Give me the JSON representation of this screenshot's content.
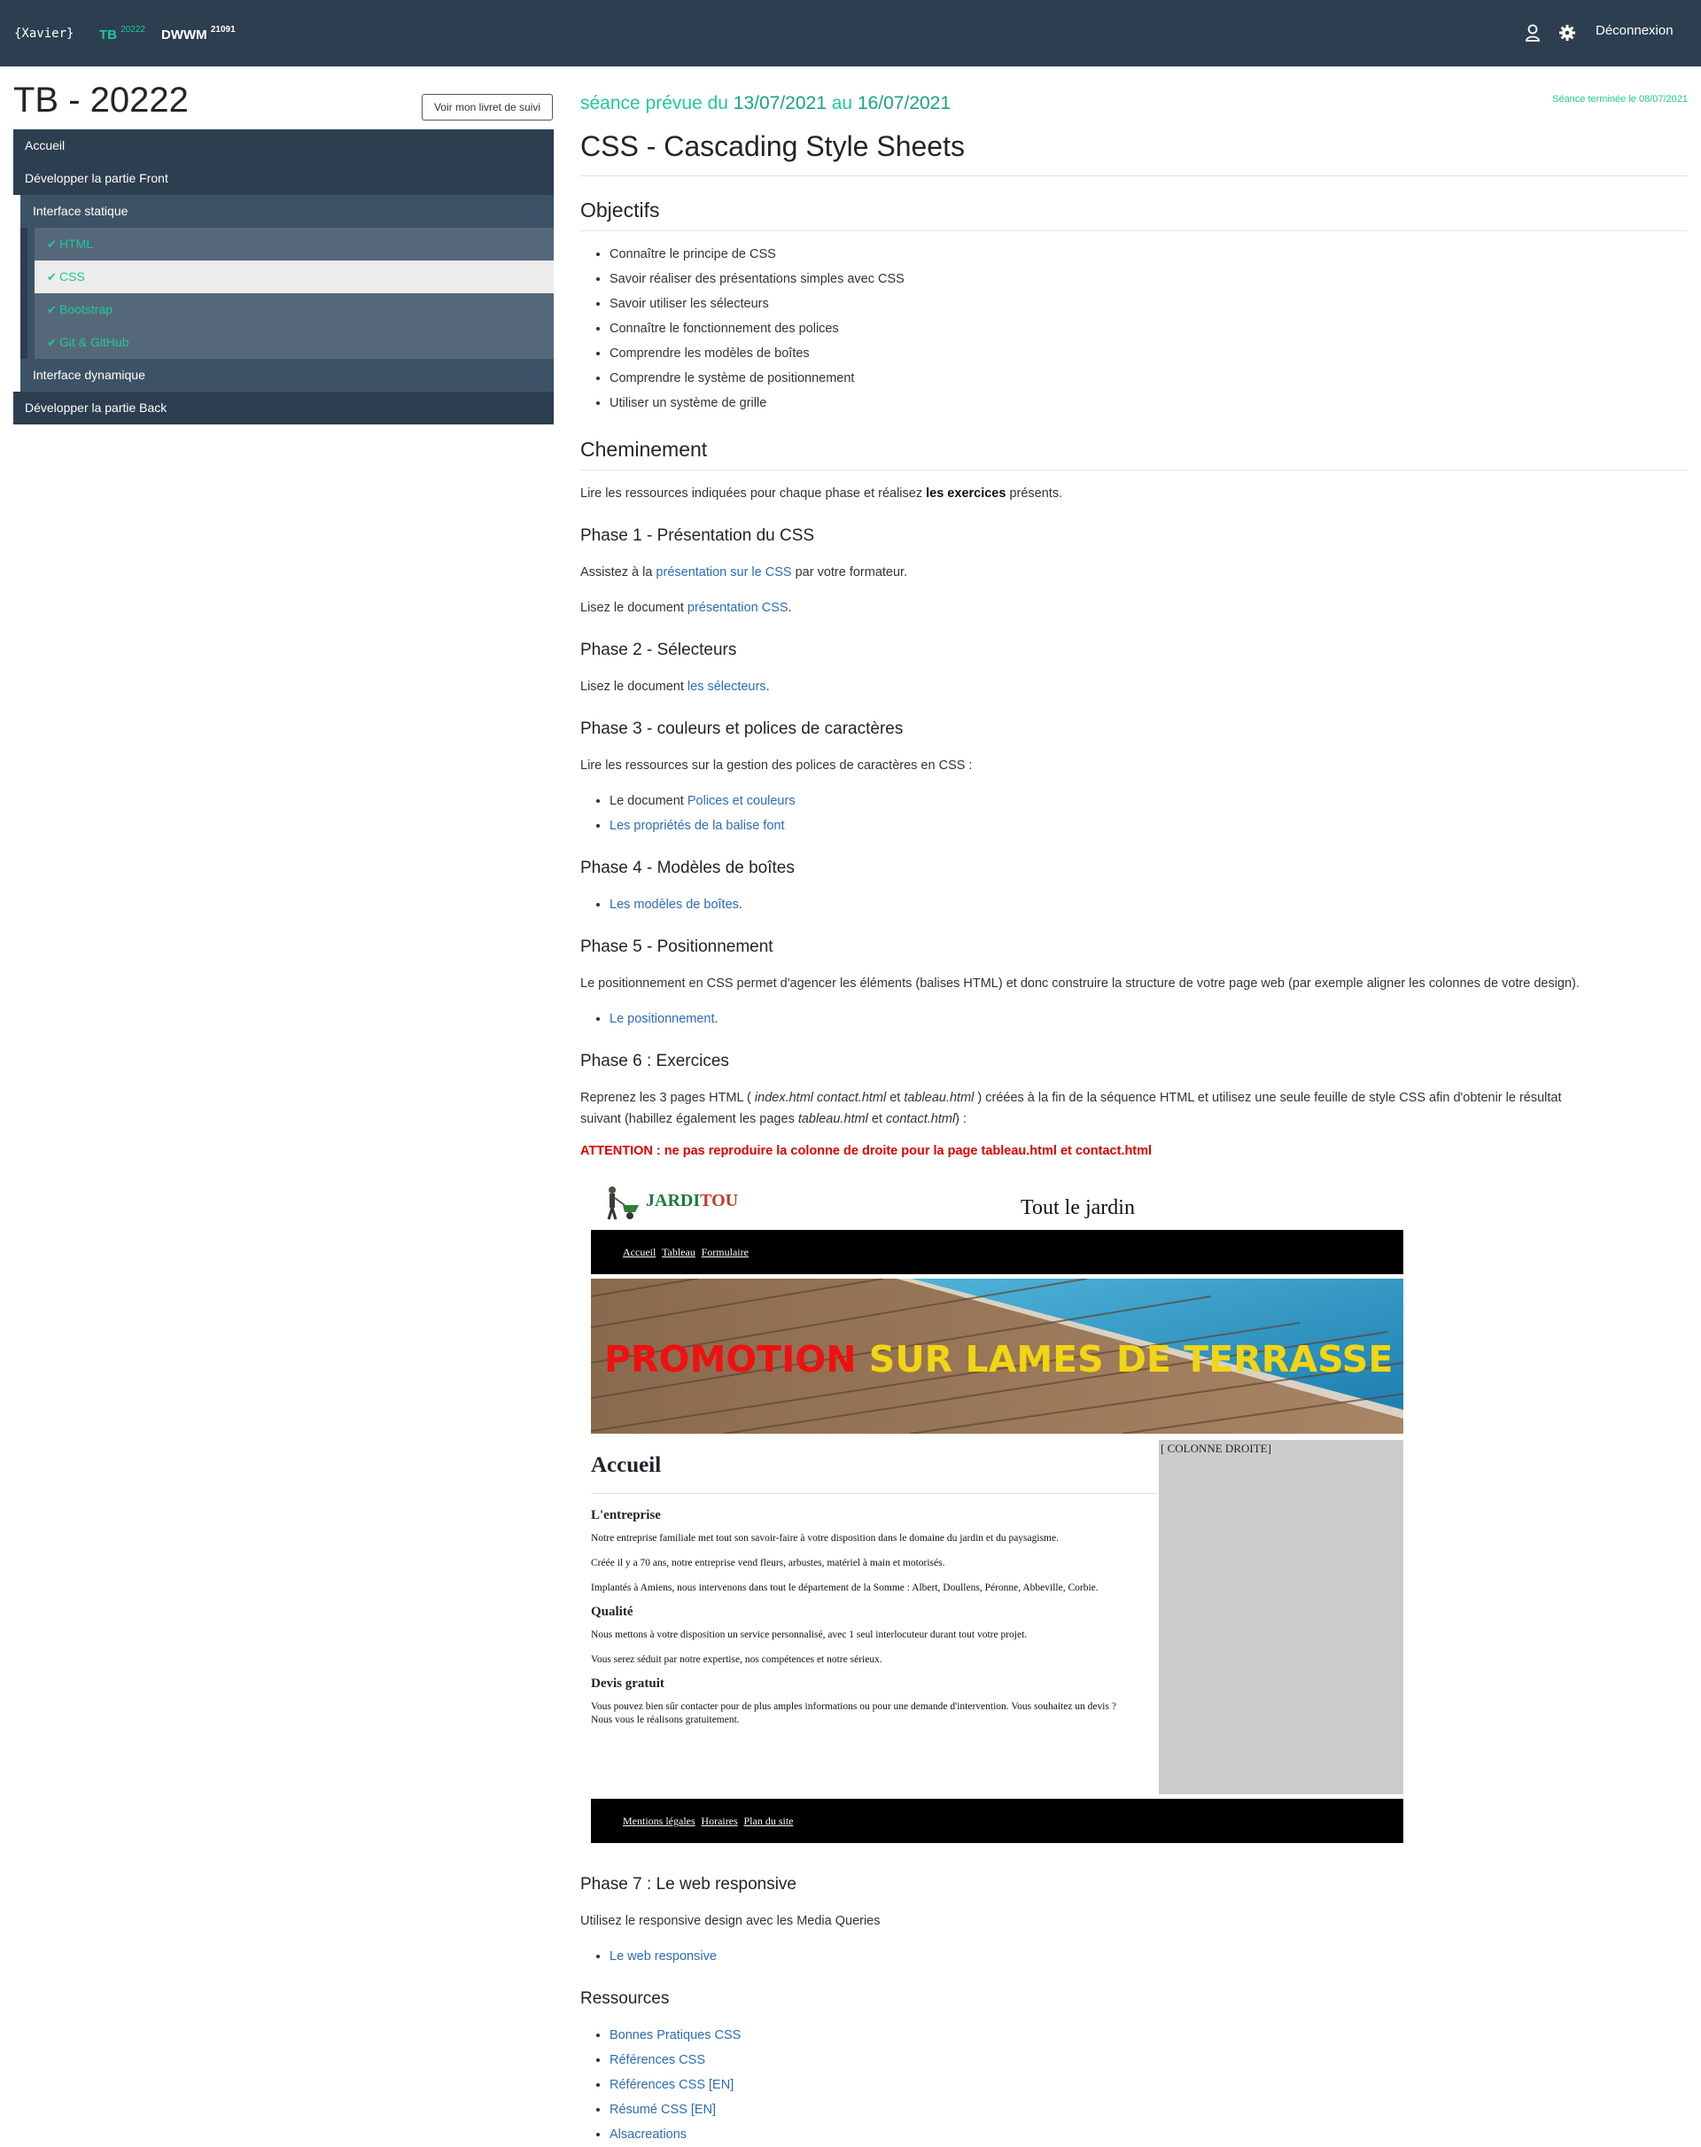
{
  "topbar": {
    "brand": "{Xavier}",
    "tb_label": "TB",
    "tb_sup": "20222",
    "dwwm_label": "DWWM",
    "dwwm_sup": "21091",
    "user_icon": "user-icon",
    "settings_icon": "gear-icon",
    "logout": "Déconnexion"
  },
  "sidebar": {
    "title": "TB - 20222",
    "livret_button": "Voir mon livret de suivi",
    "items": [
      {
        "label": "Accueil"
      },
      {
        "label": "Développer la partie Front"
      },
      {
        "label": "Interface statique"
      },
      {
        "label": "HTML"
      },
      {
        "label": "CSS"
      },
      {
        "label": "Bootstrap"
      },
      {
        "label": "Git & GitHub"
      },
      {
        "label": "Interface dynamique"
      },
      {
        "label": "Développer la partie Back"
      }
    ]
  },
  "main": {
    "seance_prefix": "séance prévue du ",
    "date_start": "13/07/2021",
    "seance_mid": " au ",
    "date_end": "16/07/2021",
    "seance_done": "Séance terminée le 08/07/2021",
    "title": "CSS - Cascading Style Sheets",
    "objectifs_title": "Objectifs",
    "objectifs": [
      "Connaître le principe de CSS",
      "Savoir réaliser des présentations simples avec CSS",
      "Savoir utiliser les sélecteurs",
      "Connaître le fonctionnement des polices",
      "Comprendre les modèles de boîtes",
      "Comprendre le système de positionnement",
      "Utiliser un système de grille"
    ],
    "cheminement_title": "Cheminement",
    "cheminement_intro_a": "Lire les ressources indiquées pour chaque phase et réalisez ",
    "cheminement_intro_b": "les exercices",
    "cheminement_intro_c": " présents.",
    "phase1_title": "Phase 1 - Présentation du CSS",
    "phase1_p1_a": "Assistez à la ",
    "phase1_p1_link": "présentation sur le CSS",
    "phase1_p1_b": " par votre formateur.",
    "phase1_p2_a": "Lisez le document ",
    "phase1_p2_link": "présentation CSS",
    "phase1_p2_b": ".",
    "phase2_title": "Phase 2 - Sélecteurs",
    "phase2_p_a": "Lisez le document ",
    "phase2_p_link": "les sélecteurs",
    "phase2_p_b": ".",
    "phase3_title": "Phase 3 - couleurs et polices de caractères",
    "phase3_p": "Lire les ressources sur la gestion des polices de caractères en CSS :",
    "phase3_li1_a": "Le document ",
    "phase3_li1_link": "Polices et couleurs",
    "phase3_li2_link": "Les propriétés de la balise font",
    "phase4_title": "Phase 4 - Modèles de boîtes",
    "phase4_li_link": "Les modèles de boîtes",
    "phase4_li_b": ".",
    "phase5_title": "Phase 5 - Positionnement",
    "phase5_p": "Le positionnement en CSS permet d'agencer les éléments (balises HTML) et donc construire la structure de votre page web (par exemple aligner les colonnes de votre design).",
    "phase5_li_link": "Le positionnement",
    "phase5_li_b": ".",
    "phase6_title": "Phase 6 : Exercices",
    "phase6_p_a": "Reprenez les 3 pages HTML ( ",
    "phase6_p_i1": "index.html contact.html",
    "phase6_p_b": " et ",
    "phase6_p_i2": "tableau.html",
    "phase6_p_c": " ) créées à la fin de la séquence HTML et utilisez une seule feuille de style CSS afin d'obtenir le résultat",
    "phase6_p2_a": "suivant (habillez également les pages ",
    "phase6_p2_i1": "tableau.html",
    "phase6_p2_b": " et ",
    "phase6_p2_i2": "contact.html",
    "phase6_p2_c": ") :",
    "attention": "ATTENTION : ne pas reproduire la colonne de droite pour la page tableau.html et contact.html",
    "phase7_title": "Phase 7 : Le web responsive",
    "phase7_p": "Utilisez le responsive design avec les Media Queries",
    "phase7_li_link": "Le web responsive",
    "ressources_title": "Ressources",
    "ressources": [
      "Bonnes Pratiques CSS",
      "Références CSS",
      "Références CSS [EN]",
      "Résumé CSS [EN]",
      "Alsacreations"
    ]
  },
  "jarditou": {
    "logo_a": "JARDI",
    "logo_b": "TOU",
    "tagline": "Tout le jardin",
    "nav": [
      "Accueil",
      "Tableau",
      "Formulaire"
    ],
    "promo_a": "PROMOTION",
    "promo_b": " SUR LAMES DE TERRASSE",
    "right_col": "[ COLONNE DROITE]",
    "h1": "Accueil",
    "h_entreprise": "L'entreprise",
    "p1": "Notre entreprise familiale met tout son savoir-faire à votre disposition dans le domaine du jardin et du paysagisme.",
    "p2": "Créée il y a 70 ans, notre entreprise vend fleurs, arbustes, matériel à main et motorisés.",
    "p3": "Implantés à Amiens, nous intervenons dans tout le département de la Somme : Albert, Doullens, Péronne, Abbeville, Corbie.",
    "h_qualite": "Qualité",
    "p4": "Nous mettons à votre disposition un service personnalisé, avec 1 seul interlocuteur durant tout votre projet.",
    "p5": "Vous serez séduit par notre expertise, nos compétences et notre sérieux.",
    "h_devis": "Devis gratuit",
    "p6": "Vous pouvez bien sûr contacter pour de plus amples informations ou pour une demande d'intervention. Vous souhaitez un devis ? Nous vous le réalisons gratuitement.",
    "footer": [
      "Mentions légales",
      "Horaires",
      "Plan du site"
    ]
  },
  "colors": {
    "navbar": "#2c3e50",
    "accent": "#20c997",
    "link": "#2b6cb8",
    "alert": "#e00000",
    "promo_red": "#ee1111",
    "promo_yellow": "#f2d513"
  }
}
